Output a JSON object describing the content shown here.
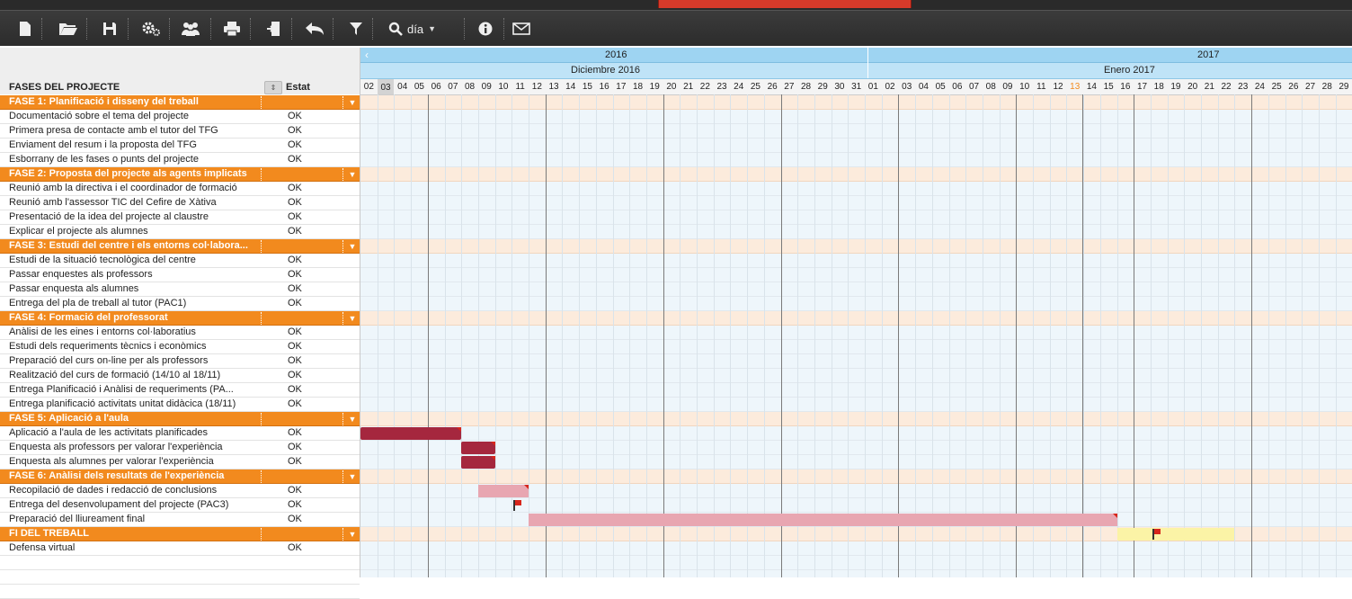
{
  "toolbar": {
    "items": [
      {
        "icon": "new-document-icon"
      },
      {
        "icon": "open-folder-icon"
      },
      {
        "icon": "save-icon"
      },
      {
        "icon": "settings-icon"
      },
      {
        "icon": "users-icon"
      },
      {
        "icon": "print-icon"
      },
      {
        "icon": "exit-icon"
      },
      {
        "icon": "undo-icon"
      },
      {
        "icon": "filter-icon"
      }
    ],
    "zoom_label": "día",
    "info_icon": "info-icon",
    "mail_icon": "mail-icon"
  },
  "grid": {
    "header_phases": "FASES DEL PROJECTE",
    "header_status": "Estat"
  },
  "timeline": {
    "years": [
      {
        "label": "2016"
      },
      {
        "label": "2017"
      }
    ],
    "months": [
      {
        "label": "Diciembre 2016"
      },
      {
        "label": "Enero 2017"
      }
    ],
    "days": [
      "02",
      "03",
      "04",
      "05",
      "06",
      "07",
      "08",
      "09",
      "10",
      "11",
      "12",
      "13",
      "14",
      "15",
      "16",
      "17",
      "18",
      "19",
      "20",
      "21",
      "22",
      "23",
      "24",
      "25",
      "26",
      "27",
      "28",
      "29",
      "30",
      "31",
      "01",
      "02",
      "03",
      "04",
      "05",
      "06",
      "07",
      "08",
      "09",
      "10",
      "11",
      "12",
      "13",
      "14",
      "15",
      "16",
      "17",
      "18",
      "19",
      "20",
      "21",
      "22",
      "23",
      "24",
      "25",
      "26",
      "27",
      "28",
      "29"
    ],
    "highlighted_day_index": 1,
    "today_index": 42
  },
  "rows": [
    {
      "type": "phase",
      "name": "FASE 1: Planificació i disseny del treball"
    },
    {
      "type": "task",
      "name": "Documentació sobre el tema del projecte",
      "status": "OK"
    },
    {
      "type": "task",
      "name": "Primera presa de contacte amb el tutor del TFG",
      "status": "OK"
    },
    {
      "type": "task",
      "name": "Enviament del resum i la proposta del TFG",
      "status": "OK"
    },
    {
      "type": "task",
      "name": "Esborrany de les fases o punts del projecte",
      "status": "OK"
    },
    {
      "type": "phase",
      "name": "FASE 2: Proposta del projecte als agents implicats"
    },
    {
      "type": "task",
      "name": "Reunió amb la directiva i el coordinador de formació",
      "status": "OK"
    },
    {
      "type": "task",
      "name": "Reunió amb l'assessor TIC del Cefire de Xàtiva",
      "status": "OK"
    },
    {
      "type": "task",
      "name": "Presentació de la idea del projecte al claustre",
      "status": "OK"
    },
    {
      "type": "task",
      "name": "Explicar el projecte als alumnes",
      "status": "OK"
    },
    {
      "type": "phase",
      "name": "FASE 3: Estudi del centre i els entorns col·labora..."
    },
    {
      "type": "task",
      "name": "Estudi de la situació tecnològica del centre",
      "status": "OK"
    },
    {
      "type": "task",
      "name": "Passar enquestes als professors",
      "status": "OK"
    },
    {
      "type": "task",
      "name": "Passar enquesta als alumnes",
      "status": "OK"
    },
    {
      "type": "task",
      "name": "Entrega del pla de treball al tutor (PAC1)",
      "status": "OK"
    },
    {
      "type": "phase",
      "name": "FASE 4: Formació del professorat"
    },
    {
      "type": "task",
      "name": "Anàlisi de les eines i entorns col·laboratius",
      "status": "OK"
    },
    {
      "type": "task",
      "name": "Estudi dels requeriments tècnics i econòmics",
      "status": "OK"
    },
    {
      "type": "task",
      "name": "Preparació del curs on-line per als professors",
      "status": "OK"
    },
    {
      "type": "task",
      "name": "Realització del curs de formació (14/10 al 18/11)",
      "status": "OK"
    },
    {
      "type": "task",
      "name": "Entrega Planificació i Anàlisi de requeriments (PA...",
      "status": "OK"
    },
    {
      "type": "task",
      "name": "Entrega planificació activitats unitat didàcica (18/11)",
      "status": "OK"
    },
    {
      "type": "phase",
      "name": "FASE 5: Aplicació a l'aula"
    },
    {
      "type": "task",
      "name": "Aplicació a l'aula de les activitats planificades",
      "status": "OK"
    },
    {
      "type": "task",
      "name": "Enquesta als professors per valorar l'experiència",
      "status": "OK"
    },
    {
      "type": "task",
      "name": "Enquesta als alumnes per valorar l'experiència",
      "status": "OK"
    },
    {
      "type": "phase",
      "name": "FASE 6: Anàlisi dels resultats de l'experiència"
    },
    {
      "type": "task",
      "name": "Recopilació de dades i redacció de conclusions",
      "status": "OK"
    },
    {
      "type": "task",
      "name": "Entrega del desenvolupament del projecte (PAC3)",
      "status": "OK"
    },
    {
      "type": "task",
      "name": "Preparació del lliureament final",
      "status": "OK"
    },
    {
      "type": "phase",
      "name": "FI DEL TREBALL"
    },
    {
      "type": "task",
      "name": "Defensa virtual",
      "status": "OK"
    }
  ],
  "bars": [
    {
      "row": 23,
      "start": "2016-12-02",
      "end": "2016-12-07",
      "style": "dark"
    },
    {
      "row": 24,
      "start": "2016-12-08",
      "end": "2016-12-09",
      "style": "dark"
    },
    {
      "row": 25,
      "start": "2016-12-08",
      "end": "2016-12-09",
      "style": "dark"
    },
    {
      "row": 27,
      "start": "2016-12-09",
      "end": "2016-12-11",
      "style": "light"
    },
    {
      "row": 29,
      "start": "2016-12-12",
      "end": "2017-01-15",
      "style": "light"
    },
    {
      "row": 30,
      "start": "2017-01-16",
      "end": "2017-01-22",
      "style": "yellow"
    }
  ],
  "milestones": [
    {
      "row": 28,
      "date": "2016-12-11"
    },
    {
      "row": 30,
      "date": "2017-01-18"
    }
  ],
  "colors": {
    "phase_row": "#f28a1e",
    "bar_dark": "#a5273e",
    "bar_light": "#e8a6b1",
    "bar_yellow": "#fbf3a6",
    "milestone_flag": "#d7261b"
  }
}
